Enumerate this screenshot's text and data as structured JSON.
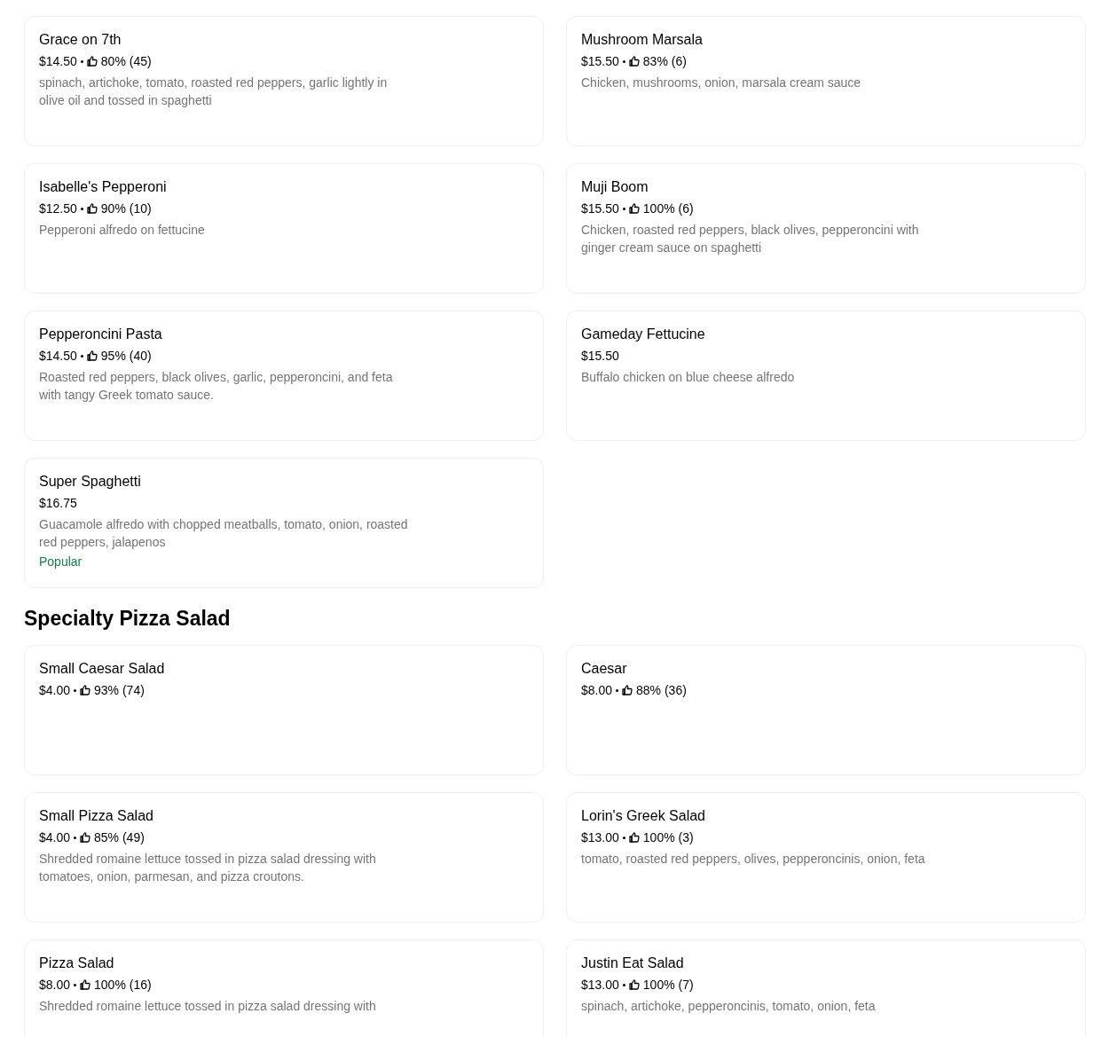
{
  "sections": [
    {
      "items": [
        {
          "name": "Grace on 7th",
          "price": "$14.50",
          "rating": "80% (45)",
          "description": "spinach, artichoke, tomato, roasted red peppers, garlic lightly in olive oil and tossed in spaghetti"
        },
        {
          "name": "Mushroom Marsala",
          "price": "$15.50",
          "rating": "83% (6)",
          "description": "Chicken, mushrooms, onion, marsala cream sauce"
        },
        {
          "name": "Isabelle's Pepperoni",
          "price": "$12.50",
          "rating": "90% (10)",
          "description": "Pepperoni alfredo on fettucine"
        },
        {
          "name": "Muji Boom",
          "price": "$15.50",
          "rating": "100% (6)",
          "description": "Chicken, roasted red peppers, black olives, pepperoncini with ginger cream sauce on spaghetti"
        },
        {
          "name": "Pepperoncini Pasta",
          "price": "$14.50",
          "rating": "95% (40)",
          "description": "Roasted red peppers, black olives, garlic, pepperoncini, and feta with tangy Greek tomato sauce."
        },
        {
          "name": "Gameday Fettucine",
          "price": "$15.50",
          "description": "Buffalo chicken on blue cheese alfredo"
        },
        {
          "name": "Super Spaghetti",
          "price": "$16.75",
          "description": "Guacamole alfredo with chopped meatballs, tomato, onion, roasted red peppers, jalapenos",
          "badge": "Popular"
        }
      ]
    },
    {
      "title": "Specialty Pizza Salad",
      "items": [
        {
          "name": "Small Caesar Salad",
          "price": "$4.00",
          "rating": "93% (74)"
        },
        {
          "name": "Caesar",
          "price": "$8.00",
          "rating": "88% (36)"
        },
        {
          "name": "Small Pizza Salad",
          "price": "$4.00",
          "rating": "85% (49)",
          "description": "Shredded romaine lettuce tossed in pizza salad dressing with tomatoes, onion, parmesan, and pizza croutons."
        },
        {
          "name": "Lorin's Greek Salad",
          "price": "$13.00",
          "rating": "100% (3)",
          "description": "tomato, roasted red peppers, olives, pepperoncinis, onion, feta"
        },
        {
          "name": "Pizza Salad",
          "price": "$8.00",
          "rating": "100% (16)",
          "description": "Shredded romaine lettuce tossed in pizza salad dressing with"
        },
        {
          "name": "Justin Eat Salad",
          "price": "$13.00",
          "rating": "100% (7)",
          "description": "spinach, artichoke, pepperoncinis, tomato, onion, feta"
        }
      ]
    }
  ]
}
